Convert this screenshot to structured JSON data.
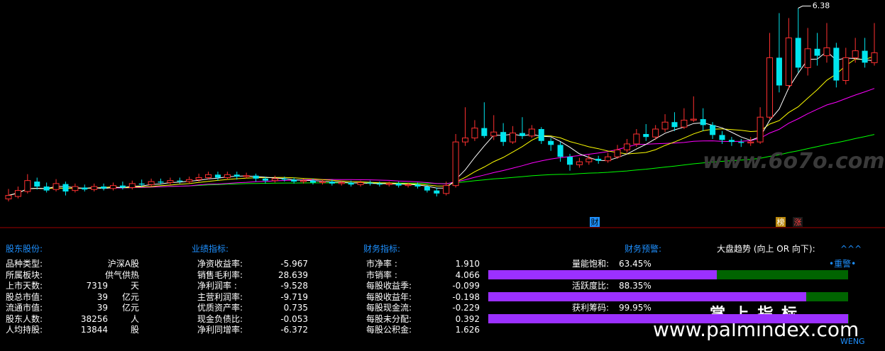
{
  "chart_data": {
    "type": "candlestick",
    "title": "",
    "ylim": [
      2.3,
      6.45
    ],
    "annotation_high": "6.38",
    "markers": [
      "财",
      "榜",
      "涨"
    ],
    "candles": [
      [
        2.55,
        2.62,
        2.75,
        2.5
      ],
      [
        2.6,
        2.72,
        2.8,
        2.56
      ],
      [
        2.7,
        2.92,
        3.05,
        2.66
      ],
      [
        2.9,
        2.8,
        2.98,
        2.74
      ],
      [
        2.8,
        2.72,
        2.88,
        2.68
      ],
      [
        2.74,
        2.86,
        2.95,
        2.7
      ],
      [
        2.85,
        2.7,
        2.9,
        2.62
      ],
      [
        2.72,
        2.8,
        2.86,
        2.68
      ],
      [
        2.78,
        2.74,
        2.84,
        2.7
      ],
      [
        2.74,
        2.8,
        2.86,
        2.7
      ],
      [
        2.8,
        2.76,
        2.86,
        2.72
      ],
      [
        2.76,
        2.82,
        2.88,
        2.72
      ],
      [
        2.82,
        2.78,
        2.9,
        2.74
      ],
      [
        2.78,
        2.86,
        2.92,
        2.74
      ],
      [
        2.86,
        2.84,
        2.94,
        2.8
      ],
      [
        2.84,
        2.9,
        2.96,
        2.8
      ],
      [
        2.9,
        2.88,
        2.96,
        2.84
      ],
      [
        2.88,
        2.92,
        2.98,
        2.84
      ],
      [
        2.92,
        2.9,
        2.98,
        2.86
      ],
      [
        2.9,
        2.94,
        3.0,
        2.86
      ],
      [
        2.94,
        2.98,
        3.06,
        2.9
      ],
      [
        2.98,
        3.04,
        3.1,
        2.94
      ],
      [
        3.04,
        2.98,
        3.1,
        2.92
      ],
      [
        2.98,
        3.04,
        3.1,
        2.94
      ],
      [
        3.04,
        3.0,
        3.1,
        2.94
      ],
      [
        3.0,
        3.02,
        3.08,
        2.96
      ],
      [
        3.02,
        2.96,
        3.06,
        2.9
      ],
      [
        2.96,
        2.92,
        3.0,
        2.86
      ],
      [
        2.92,
        2.96,
        3.02,
        2.88
      ],
      [
        2.96,
        2.94,
        3.0,
        2.9
      ],
      [
        2.94,
        2.9,
        2.98,
        2.86
      ],
      [
        2.9,
        2.92,
        2.96,
        2.86
      ],
      [
        2.92,
        2.88,
        2.96,
        2.84
      ],
      [
        2.88,
        2.9,
        2.94,
        2.84
      ],
      [
        2.9,
        2.86,
        2.94,
        2.82
      ],
      [
        2.86,
        2.88,
        2.92,
        2.82
      ],
      [
        2.88,
        2.84,
        2.92,
        2.8
      ],
      [
        2.84,
        2.88,
        2.92,
        2.8
      ],
      [
        2.88,
        2.86,
        2.92,
        2.82
      ],
      [
        2.86,
        2.84,
        2.9,
        2.8
      ],
      [
        2.84,
        2.86,
        2.9,
        2.8
      ],
      [
        2.86,
        2.82,
        2.9,
        2.78
      ],
      [
        2.82,
        2.84,
        2.88,
        2.78
      ],
      [
        2.84,
        2.8,
        2.88,
        2.76
      ],
      [
        2.8,
        2.72,
        2.84,
        2.68
      ],
      [
        2.72,
        2.66,
        2.78,
        2.6
      ],
      [
        2.66,
        2.82,
        2.9,
        2.62
      ],
      [
        2.82,
        3.7,
        3.86,
        2.78
      ],
      [
        3.7,
        3.78,
        4.4,
        3.62
      ],
      [
        3.78,
        3.98,
        4.14,
        3.72
      ],
      [
        3.98,
        3.82,
        4.5,
        3.78
      ],
      [
        3.82,
        3.9,
        4.24,
        3.74
      ],
      [
        3.9,
        3.7,
        4.08,
        3.62
      ],
      [
        3.7,
        3.88,
        4.02,
        3.66
      ],
      [
        3.88,
        3.82,
        4.2,
        3.76
      ],
      [
        3.82,
        3.96,
        4.04,
        3.78
      ],
      [
        3.96,
        3.72,
        4.0,
        3.66
      ],
      [
        3.72,
        3.64,
        3.78,
        3.52
      ],
      [
        3.64,
        3.4,
        3.7,
        3.3
      ],
      [
        3.4,
        3.24,
        3.46,
        3.12
      ],
      [
        3.24,
        3.3,
        3.38,
        3.18
      ],
      [
        3.3,
        3.36,
        3.44,
        3.24
      ],
      [
        3.36,
        3.32,
        3.42,
        3.26
      ],
      [
        3.32,
        3.4,
        3.48,
        3.28
      ],
      [
        3.4,
        3.54,
        3.64,
        3.36
      ],
      [
        3.54,
        3.66,
        3.76,
        3.48
      ],
      [
        3.66,
        3.86,
        3.96,
        3.6
      ],
      [
        3.86,
        3.8,
        4.06,
        3.72
      ],
      [
        3.8,
        3.96,
        4.04,
        3.74
      ],
      [
        3.96,
        4.1,
        4.26,
        3.9
      ],
      [
        4.1,
        4.0,
        4.3,
        3.92
      ],
      [
        4.0,
        4.14,
        4.38,
        3.96
      ],
      [
        4.14,
        4.16,
        4.62,
        4.1
      ],
      [
        4.16,
        4.04,
        4.38,
        3.92
      ],
      [
        4.04,
        3.84,
        4.1,
        3.76
      ],
      [
        3.84,
        3.74,
        3.92,
        3.66
      ],
      [
        3.74,
        3.7,
        3.8,
        3.62
      ],
      [
        3.7,
        3.68,
        3.76,
        3.6
      ],
      [
        3.68,
        3.7,
        3.8,
        3.62
      ],
      [
        3.7,
        4.2,
        4.4,
        3.66
      ],
      [
        4.2,
        5.4,
        5.9,
        4.16
      ],
      [
        5.4,
        4.84,
        6.3,
        4.7
      ],
      [
        4.84,
        5.8,
        6.2,
        4.76
      ],
      [
        5.8,
        5.2,
        6.4,
        5.1
      ],
      [
        5.2,
        5.58,
        6.0,
        5.04
      ],
      [
        5.58,
        5.44,
        5.9,
        5.24
      ],
      [
        5.44,
        5.6,
        6.1,
        5.3
      ],
      [
        5.6,
        4.94,
        5.7,
        4.8
      ],
      [
        4.94,
        5.4,
        5.6,
        4.86
      ],
      [
        5.4,
        5.54,
        5.8,
        5.3
      ],
      [
        5.54,
        5.3,
        5.8,
        5.2
      ],
      [
        5.3,
        5.5,
        6.1,
        5.24
      ]
    ]
  },
  "panel": {
    "sec1_title": "股东股份:",
    "sec2_title": "业绩指标:",
    "sec3_title": "财务指标:",
    "sec4_title": "财务预警:",
    "market_trend_label": "大盘趋势 (向上 OR 向下):",
    "market_trend_value": "^^^",
    "shareholder": [
      {
        "label": "品种类型:",
        "value": "沪深A股",
        "unit": ""
      },
      {
        "label": "所属板块:",
        "value": "供气供热",
        "unit": ""
      },
      {
        "label": "上市天数:",
        "value": "7319",
        "unit": "天"
      },
      {
        "label": "股总市值:",
        "value": "39",
        "unit": "亿元"
      },
      {
        "label": "流通市值:",
        "value": "39",
        "unit": "亿元"
      },
      {
        "label": "股东人数:",
        "value": "38256",
        "unit": "人"
      },
      {
        "label": "人均持股:",
        "value": "13844",
        "unit": "股"
      }
    ],
    "performance": [
      {
        "label": "净资收益率:",
        "value": "-5.967"
      },
      {
        "label": "销售毛利率:",
        "value": "28.639"
      },
      {
        "label": "净利润率  :",
        "value": "-9.528"
      },
      {
        "label": "主营利润率:",
        "value": "-9.719"
      },
      {
        "label": "优质资产率:",
        "value": "0.735"
      },
      {
        "label": "现金负债比:",
        "value": "-0.053"
      },
      {
        "label": "净利同增率:",
        "value": "-6.372"
      }
    ],
    "financial": [
      {
        "label": "市净率    :",
        "value": "1.910"
      },
      {
        "label": "市销率    :",
        "value": "4.066"
      },
      {
        "label": "每股收益季:",
        "value": "-0.099"
      },
      {
        "label": "每股收益年:",
        "value": "-0.198"
      },
      {
        "label": "每股现金流:",
        "value": "-0.229"
      },
      {
        "label": "每股未分配:",
        "value": "0.392"
      },
      {
        "label": "每股公积金:",
        "value": "1.626"
      }
    ],
    "warnings": [
      {
        "label": "量能饱和:",
        "value": "63.45%",
        "pct": 0.6345,
        "tag": "•重警•"
      },
      {
        "label": "活跃度比:",
        "value": "88.35%",
        "pct": 0.8835,
        "tag": ""
      },
      {
        "label": "获利筹码:",
        "value": "99.95%",
        "pct": 0.9995,
        "tag": ""
      }
    ]
  },
  "watermarks": {
    "top": "www.6o7o.com",
    "cn": "掌 上 指 标",
    "url": "www.palmindex.com",
    "sub": "WENG"
  },
  "colors": {
    "up": "#ff3030",
    "down": "#00e5ee",
    "ma5": "#ffffff",
    "ma10": "#ffff00",
    "ma20": "#ff00ff",
    "ma60": "#00ff00",
    "header": "#1e90ff",
    "bar_fill": "#9b30ff",
    "bar_rest": "#006400"
  }
}
